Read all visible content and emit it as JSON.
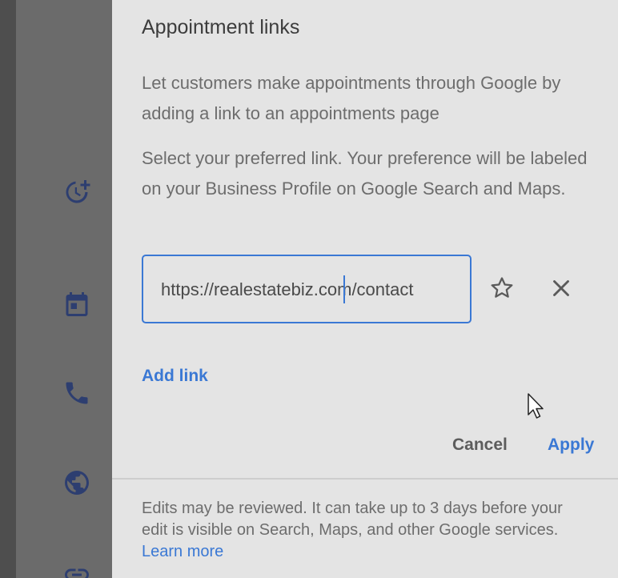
{
  "dialog": {
    "title": "Appointment links",
    "intro": "Let customers make appointments through Google by adding a link to an appointments page",
    "instructions": "Select your preferred link. Your preference will be labeled on your Business Profile on Google Search and Maps.",
    "link_field": {
      "value": "https://realestatebiz.com/contact"
    },
    "star_icon": "star-outline-icon",
    "close_icon": "close-icon",
    "add_link_label": "Add link",
    "cancel_label": "Cancel",
    "apply_label": "Apply",
    "footer_text": "Edits may be reviewed. It can take up to 3 days before your edit is visible on Search, Maps, and other Google services.",
    "learn_more_label": "Learn more"
  },
  "background": {
    "icons": [
      "more-hours-icon",
      "calendar-icon",
      "phone-icon",
      "globe-icon",
      "link-icon"
    ]
  },
  "colors": {
    "accent": "#3a78d4",
    "dialog_bg": "#e4e4e4",
    "overlay": "#6b6b6b"
  }
}
